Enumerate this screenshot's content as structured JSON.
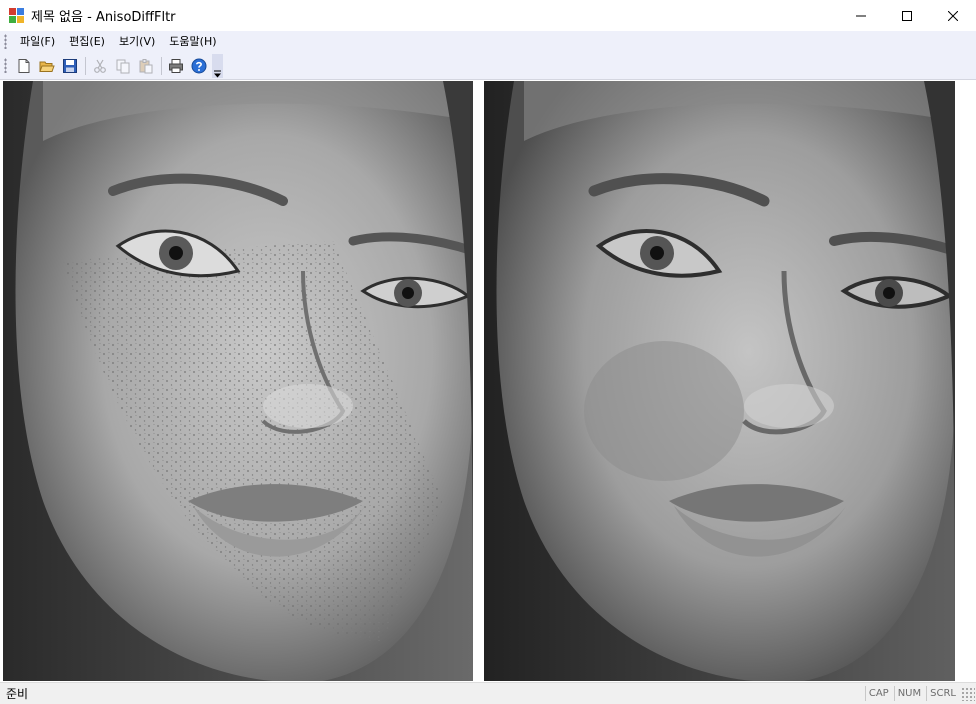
{
  "window": {
    "title": "제목 없음 - AnisoDiffFltr",
    "app_icon": "mfc-app-icon",
    "controls": [
      "minimize-icon",
      "maximize-icon",
      "close-icon"
    ]
  },
  "menu": {
    "items": [
      {
        "label": "파일(F)"
      },
      {
        "label": "편집(E)"
      },
      {
        "label": "보기(V)"
      },
      {
        "label": "도움말(H)"
      }
    ]
  },
  "toolbar": {
    "buttons": [
      {
        "icon": "new-file-icon",
        "enabled": true
      },
      {
        "icon": "open-folder-icon",
        "enabled": true
      },
      {
        "icon": "save-icon",
        "enabled": true
      },
      {
        "icon": "cut-icon",
        "enabled": false
      },
      {
        "icon": "copy-icon",
        "enabled": false
      },
      {
        "icon": "paste-icon",
        "enabled": false
      },
      {
        "icon": "print-icon",
        "enabled": true
      },
      {
        "icon": "help-icon",
        "enabled": true
      }
    ],
    "overflow_icon": "toolbar-overflow-icon"
  },
  "view": {
    "images": [
      {
        "name": "original-image",
        "description_icon": "portrait-photo"
      },
      {
        "name": "filtered-image",
        "description_icon": "portrait-photo"
      }
    ]
  },
  "status": {
    "text": "준비",
    "indicators": [
      "CAP",
      "NUM",
      "SCRL"
    ]
  },
  "colors": {
    "menubar_bg": "#eef0fa",
    "statusbar_bg": "#f0f0f0"
  }
}
